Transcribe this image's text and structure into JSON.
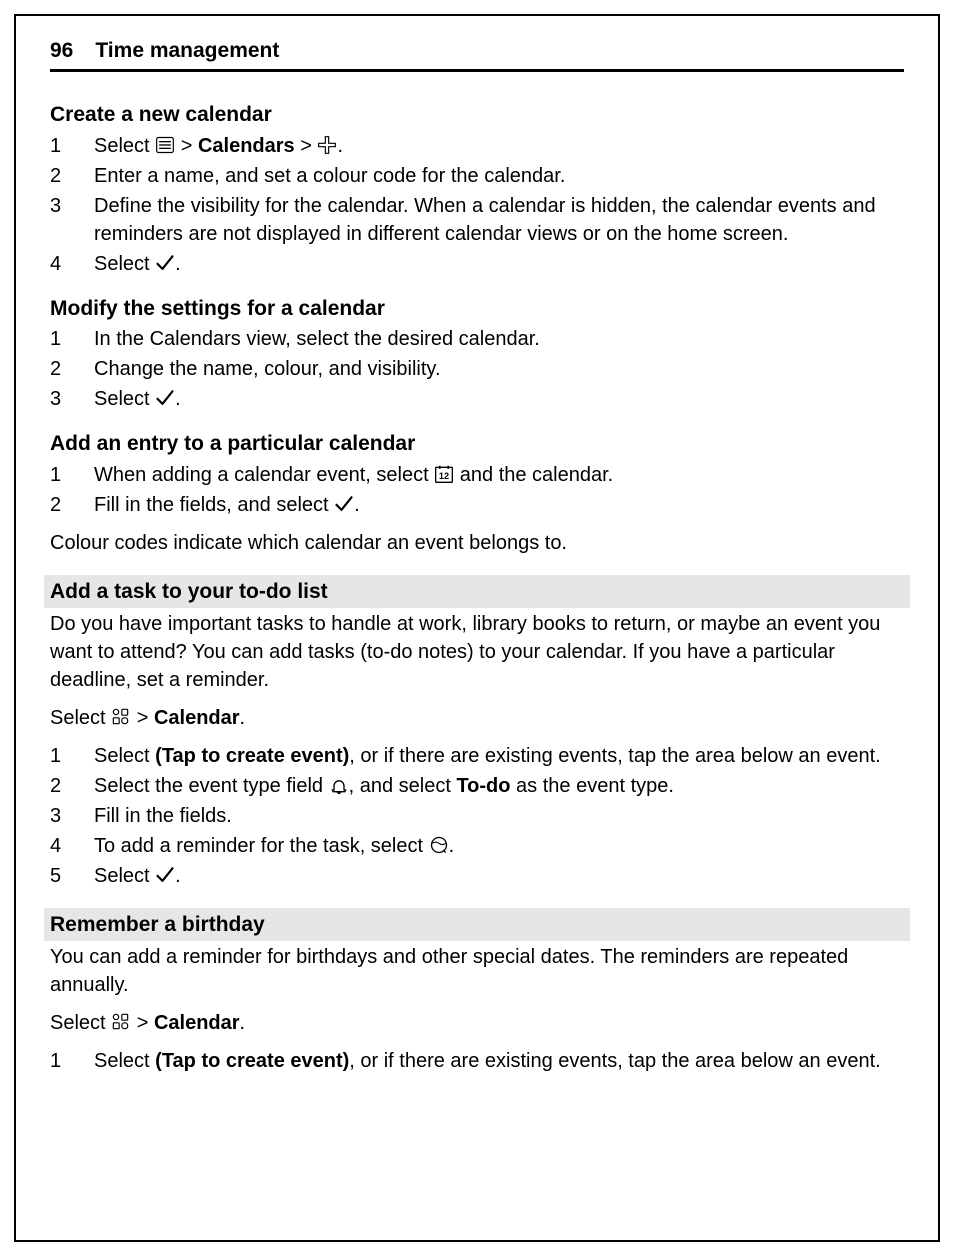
{
  "header": {
    "page_number": "96",
    "title": "Time management"
  },
  "sections": {
    "create_cal": {
      "heading": "Create a new calendar",
      "step1_pre": "Select ",
      "step1_mid": " > ",
      "step1_bold": "Calendars",
      "step1_post": "  > ",
      "step1_end": ".",
      "step2": "Enter a name, and set a colour code for the calendar.",
      "step3": "Define the visibility for the calendar. When a calendar is hidden, the calendar events and reminders are not displayed in different calendar views or on the home screen.",
      "step4_pre": "Select ",
      "step4_post": "."
    },
    "modify_cal": {
      "heading": "Modify the settings for a calendar",
      "step1": "In the Calendars view, select the desired calendar.",
      "step2": "Change the name, colour, and visibility.",
      "step3_pre": "Select ",
      "step3_post": "."
    },
    "add_entry": {
      "heading": "Add an entry to a particular calendar",
      "step1_pre": "When adding a calendar event, select ",
      "step1_post": " and the calendar.",
      "step2_pre": "Fill in the fields, and select ",
      "step2_post": ".",
      "note": "Colour codes indicate which calendar an event belongs to."
    },
    "todo": {
      "heading": "Add a task to your to-do list",
      "intro": "Do you have important tasks to handle at work, library books to return, or maybe an event you want to attend? You can add tasks (to-do notes) to your calendar. If you have a particular deadline, set a reminder.",
      "select_pre": "Select ",
      "select_mid": "  > ",
      "select_bold": "Calendar",
      "select_post": ".",
      "step1_pre": "Select ",
      "step1_bold": "(Tap to create event)",
      "step1_post": ", or if there are existing events, tap the area below an event.",
      "step2_pre": "Select the event type field ",
      "step2_mid": ", and select ",
      "step2_bold": "To-do",
      "step2_post": " as the event type.",
      "step3": "Fill in the fields.",
      "step4_pre": "To add a reminder for the task, select ",
      "step4_post": ".",
      "step5_pre": "Select ",
      "step5_post": "."
    },
    "birthday": {
      "heading": "Remember a birthday",
      "intro": "You can add a reminder for birthdays and other special dates. The reminders are repeated annually.",
      "select_pre": "Select ",
      "select_mid": "  > ",
      "select_bold": "Calendar",
      "select_post": ".",
      "step1_pre": "Select ",
      "step1_bold": "(Tap to create event)",
      "step1_post": ", or if there are existing events, tap the area below an event."
    }
  }
}
